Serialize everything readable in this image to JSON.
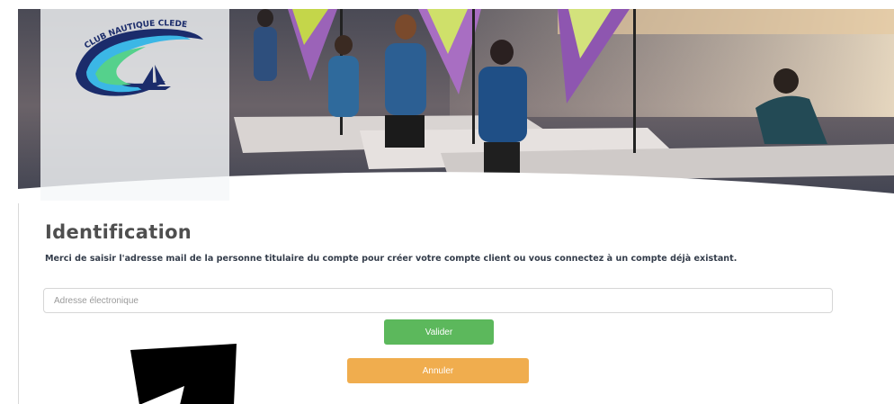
{
  "logo": {
    "text": "CLUB NAUTIQUE CLEDEROIS",
    "colors": {
      "ring_outer": "#1b2c6b",
      "ring_inner": "#3bb7e6",
      "ring_green": "#55d18c"
    }
  },
  "hero": {
    "description_icon": "sailing-photo",
    "colors": {
      "sea_dark": "#3c3a46",
      "sea_light": "#b8a89a",
      "sand": "#e8c9a2"
    }
  },
  "form": {
    "title": "Identification",
    "instructions": "Merci de saisir l'adresse mail de la personne titulaire du compte pour créer votre compte client ou vous connectez à un compte déjà existant.",
    "email_placeholder": "Adresse électronique",
    "email_value": "",
    "validate_label": "Valider",
    "cancel_label": "Annuler"
  },
  "colors": {
    "validate": "#5cb85c",
    "cancel": "#f0ad4e",
    "title": "#4f4f4f",
    "instructions": "#333c4a"
  }
}
